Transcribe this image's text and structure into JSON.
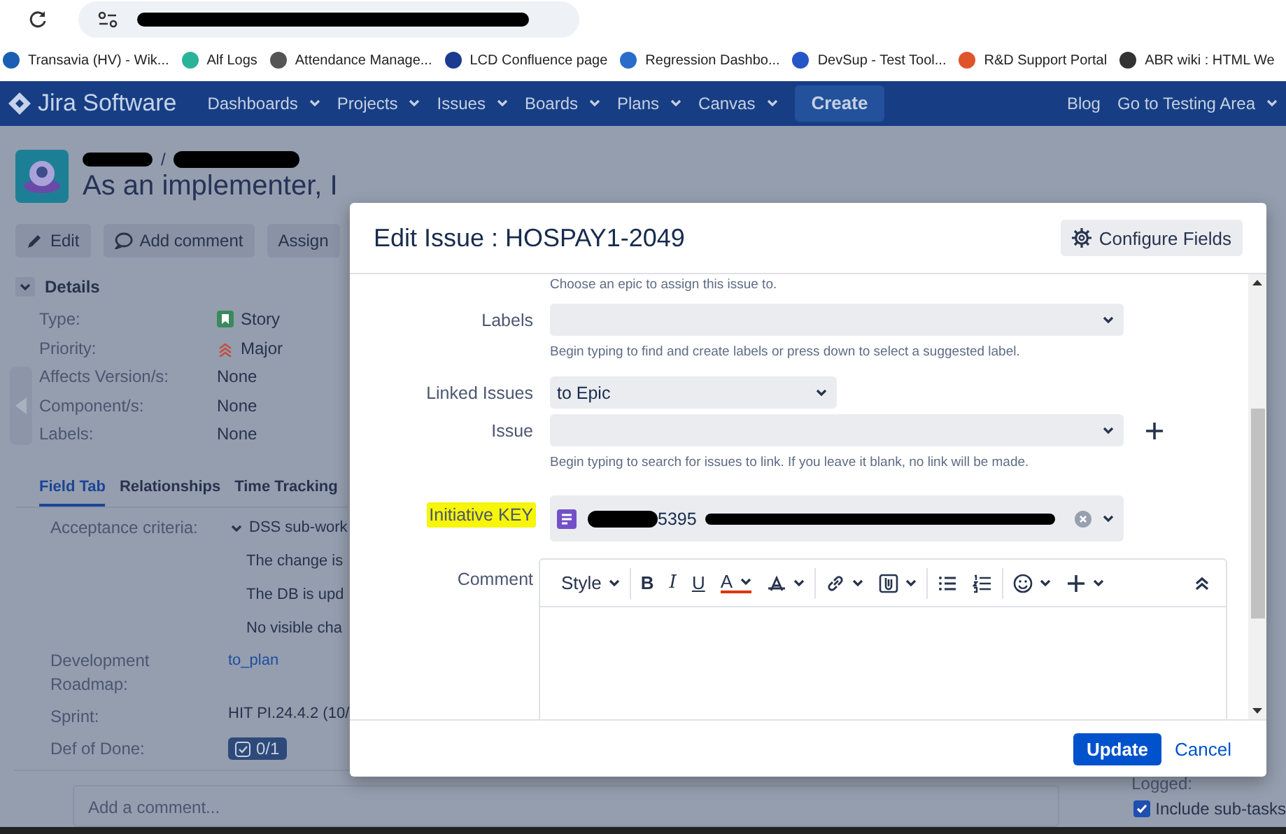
{
  "bookmarks": [
    {
      "label": "Transavia (HV) - Wik...",
      "color": "#1a5fb4"
    },
    {
      "label": "Alf Logs",
      "color": "#2bb39a"
    },
    {
      "label": "Attendance Manage...",
      "color": "#555555"
    },
    {
      "label": "LCD Confluence page",
      "color": "#1c3a8f"
    },
    {
      "label": "Regression Dashbo...",
      "color": "#2a6cc9"
    },
    {
      "label": "DevSup - Test Tool...",
      "color": "#2456c8"
    },
    {
      "label": "R&D Support Portal",
      "color": "#e0542c"
    },
    {
      "label": "ABR wiki : HTML We",
      "color": "#333333"
    }
  ],
  "nav": {
    "brand": "Jira Software",
    "items": [
      "Dashboards",
      "Projects",
      "Issues",
      "Boards",
      "Plans",
      "Canvas"
    ],
    "create": "Create",
    "right": [
      {
        "label": "Blog",
        "dropdown": false
      },
      {
        "label": "Go to Testing Area",
        "dropdown": true
      }
    ]
  },
  "issue": {
    "breadcrumb_separator": "/",
    "title": "As an implementer, I",
    "actions": [
      "Edit",
      "Add comment",
      "Assign"
    ],
    "details": {
      "heading": "Details",
      "expanded": true,
      "fields": [
        {
          "label": "Type:",
          "value": "Story",
          "kind": "story"
        },
        {
          "label": "Priority:",
          "value": "Major",
          "kind": "major"
        },
        {
          "label": "Affects Version/s:",
          "value": "None",
          "kind": "plain"
        },
        {
          "label": "Component/s:",
          "value": "None",
          "kind": "plain"
        },
        {
          "label": "Labels:",
          "value": "None",
          "kind": "plain"
        }
      ]
    },
    "tabs": [
      {
        "label": "Field Tab",
        "selected": true
      },
      {
        "label": "Relationships",
        "selected": false
      },
      {
        "label": "Time Tracking",
        "selected": false
      }
    ],
    "acceptance": {
      "label": "Acceptance criteria:",
      "expanded": true,
      "heading": "DSS sub-work",
      "lines": [
        "The change is",
        "The DB is upd",
        "No visible cha"
      ]
    },
    "roadmap": {
      "label": "Development Roadmap:",
      "value": "to_plan"
    },
    "sprint": {
      "label": "Sprint:",
      "value": "HIT PI.24.4.2 (10/"
    },
    "dod": {
      "label": "Def of Done:",
      "value": "0/1"
    },
    "comment_placeholder": "Add a comment...",
    "logged": "Logged:",
    "subtasks": {
      "label": "Include sub-tasks",
      "checked": true
    }
  },
  "modal": {
    "title": "Edit Issue : HOSPAY1-2049",
    "configure": "Configure Fields",
    "epic_hint": "Choose an epic to assign this issue to.",
    "labels": {
      "label": "Labels",
      "hint": "Begin typing to find and create labels or press down to select a suggested label."
    },
    "linked": {
      "label": "Linked Issues",
      "value": "to Epic"
    },
    "issue": {
      "label": "Issue",
      "hint": "Begin typing to search for issues to link. If you leave it blank, no link will be made."
    },
    "initiative": {
      "label": "Initiative KEY",
      "highlighted": true,
      "value": "5395"
    },
    "comment": {
      "label": "Comment",
      "toolbar": [
        [
          {
            "kind": "style",
            "label": "Style"
          }
        ],
        [
          {
            "kind": "bold",
            "label": "B"
          },
          {
            "kind": "italic",
            "label": "I"
          },
          {
            "kind": "underline",
            "label": "U"
          },
          {
            "kind": "color",
            "label": "A"
          },
          {
            "kind": "format"
          }
        ],
        [
          {
            "kind": "link"
          },
          {
            "kind": "attach"
          }
        ],
        [
          {
            "kind": "bullets"
          },
          {
            "kind": "numbers"
          }
        ],
        [
          {
            "kind": "emoji"
          },
          {
            "kind": "insert"
          }
        ]
      ]
    },
    "update": "Update",
    "cancel": "Cancel"
  }
}
